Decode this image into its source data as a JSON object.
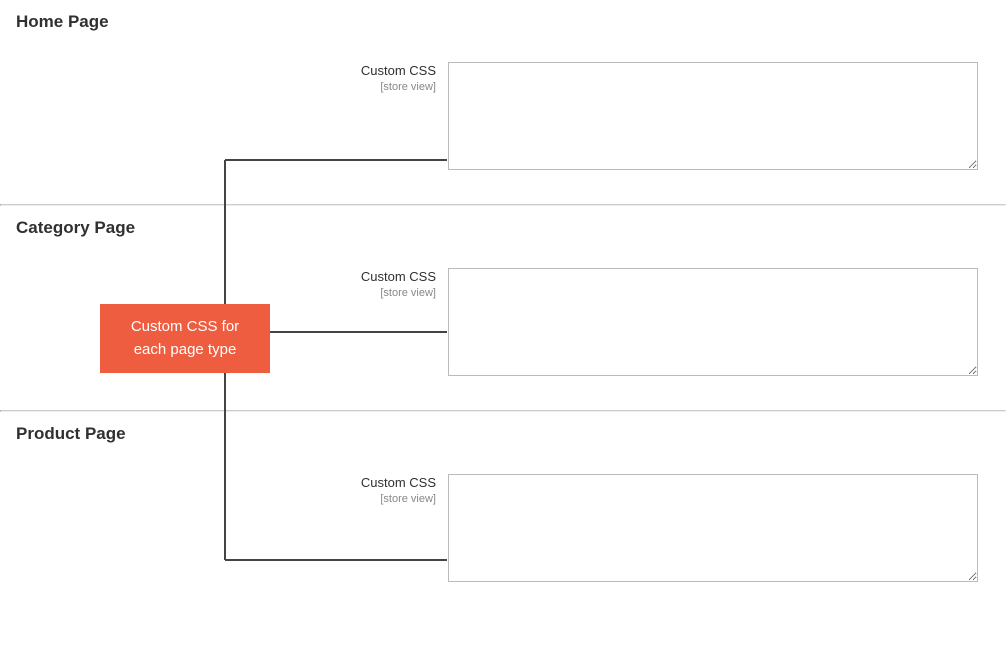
{
  "sections": [
    {
      "title": "Home Page",
      "field_label": "Custom CSS",
      "scope": "[store view]",
      "value": ""
    },
    {
      "title": "Category Page",
      "field_label": "Custom CSS",
      "scope": "[store view]",
      "value": ""
    },
    {
      "title": "Product Page",
      "field_label": "Custom CSS",
      "scope": "[store view]",
      "value": ""
    }
  ],
  "callout": {
    "line1": "Custom CSS for",
    "line2": "each page type"
  }
}
